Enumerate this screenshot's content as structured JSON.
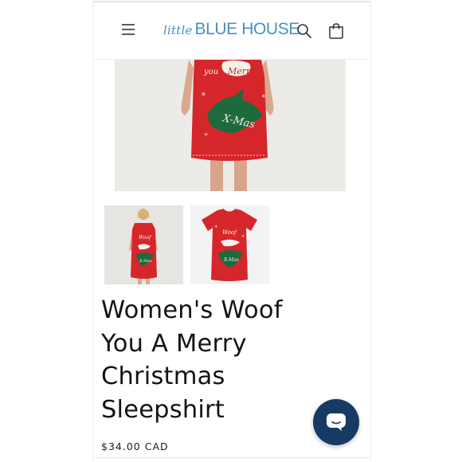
{
  "header": {
    "logo_script": "little",
    "logo_main": "BLUE HOUSE"
  },
  "product": {
    "title_lines": [
      "Women's Woof",
      "You A Merry",
      "Christmas",
      "Sleepshirt"
    ],
    "price": "$34.00 CAD",
    "print_text": {
      "woof": "Woof",
      "you": "you",
      "merry": "Merry",
      "xmas": "X-Mas"
    }
  },
  "colors": {
    "brand_blue": "#4a90c0",
    "shirt_red": "#d5272b",
    "tree_green": "#1d6a3c",
    "chat_navy": "#173a64"
  },
  "icons": [
    "menu-icon",
    "search-icon",
    "cart-icon",
    "chat-icon"
  ]
}
